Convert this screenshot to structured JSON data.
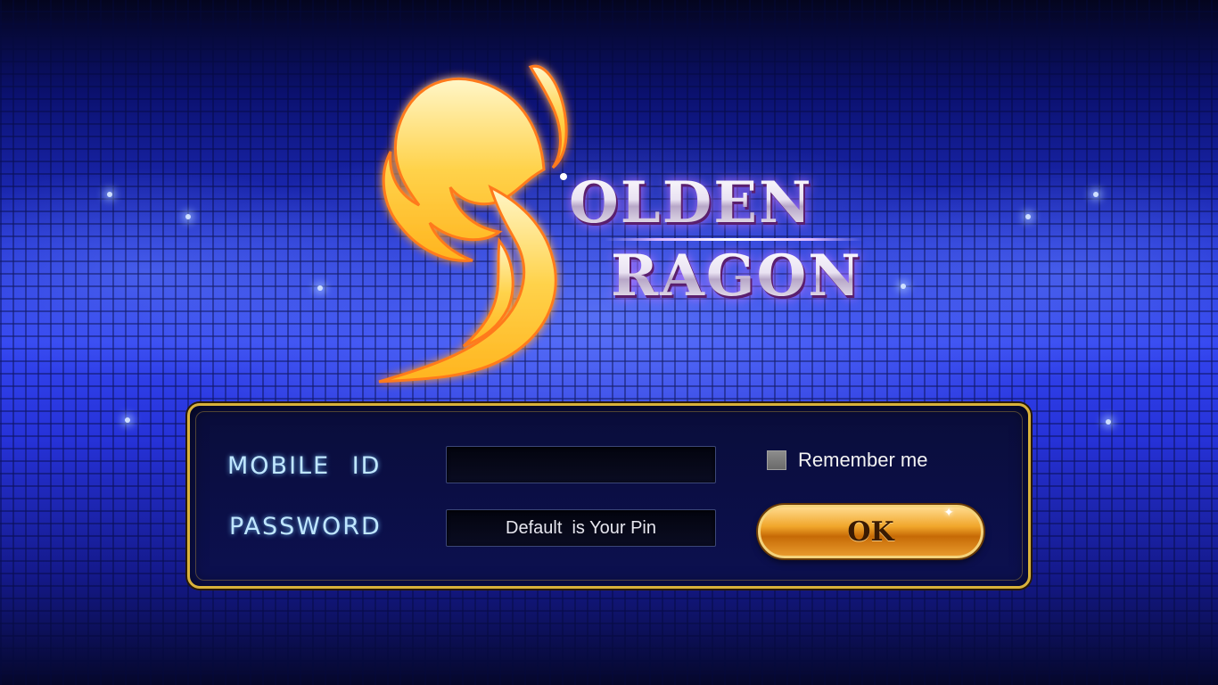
{
  "logo": {
    "line_1": "OLDEN",
    "line_2": "RAGON"
  },
  "login": {
    "mobile_id_label": "MOBILE ID",
    "mobile_id_value": "",
    "password_label": "PASSWORD",
    "password_placeholder": "Default  is Your Pin",
    "remember_label": "Remember me",
    "remember_checked": false,
    "ok_label": "OK"
  },
  "colors": {
    "accent_gold": "#d9b23a",
    "label_cyan": "#bfe6ff",
    "background_blue": "#3345f0"
  }
}
